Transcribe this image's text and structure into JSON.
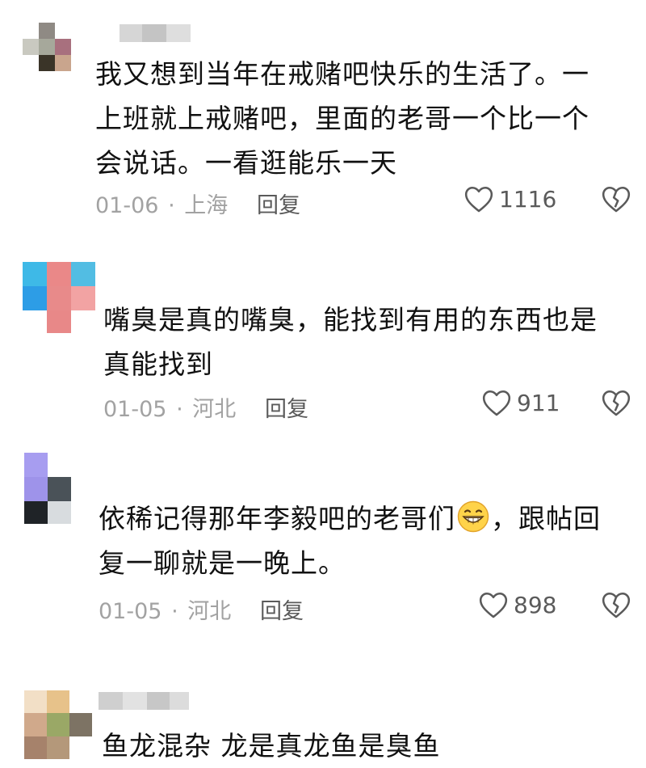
{
  "comments": [
    {
      "lines": [
        "我又想到当年在戒赌吧快乐的生活了。一",
        "上班就上戒赌吧，里面的老哥一个比一个",
        "会说话。一看逛能乐一天"
      ],
      "date": "01-06",
      "sep": "·",
      "location": "上海",
      "reply_label": "回复",
      "likes": "1116"
    },
    {
      "lines": [
        "嘴臭是真的嘴臭，能找到有用的东西也是",
        "真能找到"
      ],
      "date": "01-05",
      "sep": "·",
      "location": "河北",
      "reply_label": "回复",
      "likes": "911"
    },
    {
      "line1_before": "依稀记得那年李毅吧的老哥们",
      "line1_emoji": "grinning-face-emoji",
      "line1_after": "，跟帖回",
      "line2": "复一聊就是一晚上。",
      "date": "01-05",
      "sep": "·",
      "location": "河北",
      "reply_label": "回复",
      "likes": "898"
    },
    {
      "lines": [
        "鱼龙混杂 龙是真龙鱼是臭鱼"
      ]
    }
  ],
  "icons": {
    "like": "heart-outline-icon",
    "dislike": "broken-heart-icon"
  },
  "colors": {
    "text": "#111111",
    "meta": "#a2a2a2",
    "action": "#5a5a5a"
  }
}
